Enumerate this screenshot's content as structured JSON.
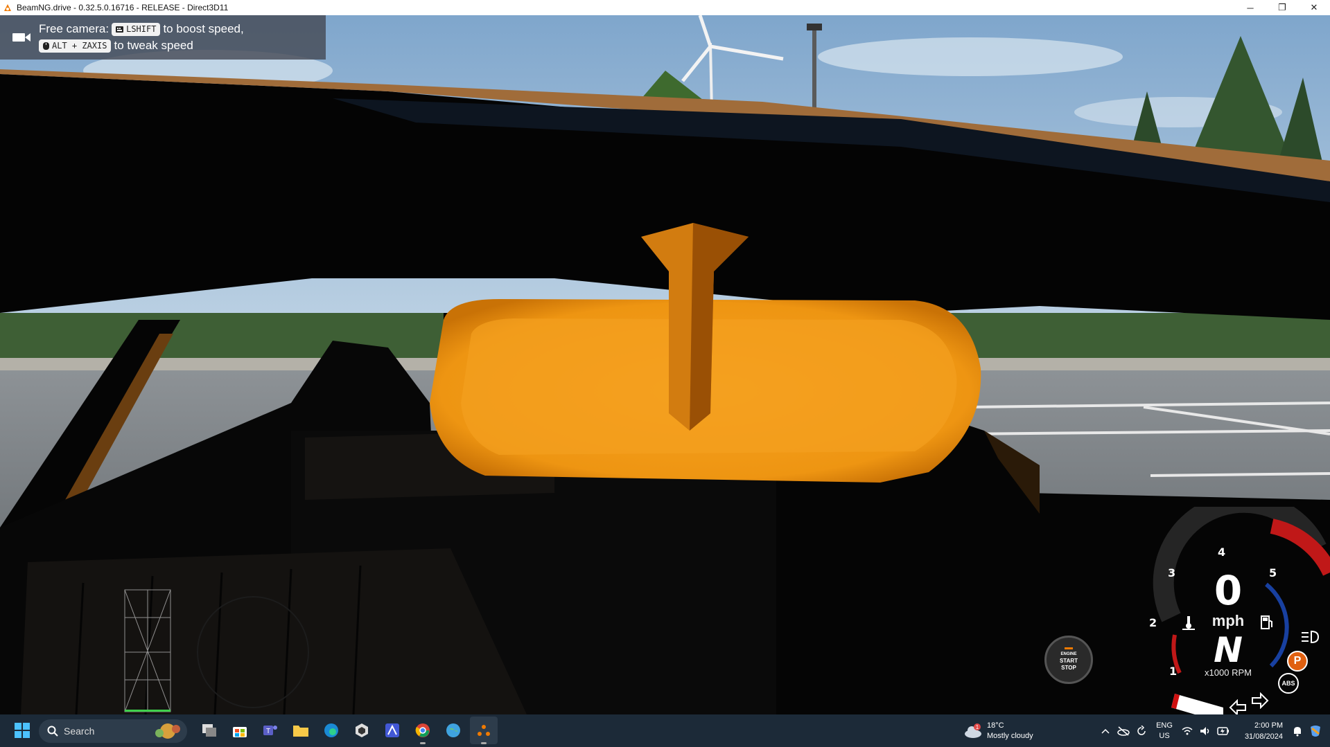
{
  "window": {
    "title": "BeamNG.drive - 0.32.5.0.16716 - RELEASE - Direct3D11",
    "minimize_glyph": "─",
    "maximize_glyph": "❐",
    "close_glyph": "✕"
  },
  "hint": {
    "line1_prefix": "Free camera:",
    "key1": "LSHIFT",
    "line1_suffix": "to boost speed,",
    "key2": "ALT + ZAXIS",
    "line2_suffix": "to tweak speed"
  },
  "hud": {
    "start_stop": {
      "line1": "ENGINE",
      "line2": "START",
      "line3": "STOP"
    },
    "speed": "0",
    "speed_unit": "mph",
    "gear": "N",
    "rpm_label": "x1000 RPM",
    "ticks": [
      "1",
      "2",
      "3",
      "4",
      "5"
    ],
    "indicators": [
      "temperature-icon",
      "fuel-icon",
      "headlight-icon",
      "parking-brake-icon",
      "abs-icon"
    ],
    "parking_label": "P",
    "abs_label": "ABS"
  },
  "taskbar": {
    "search_label": "Search",
    "weather": {
      "temp": "18°C",
      "condition": "Mostly cloudy",
      "badge": "1"
    },
    "lang": {
      "line1": "ENG",
      "line2": "US"
    },
    "time": "2:00 PM",
    "date": "31/08/2024",
    "apps": [
      "file-explorer",
      "store",
      "teams",
      "folder",
      "edge",
      "unity",
      "affinity",
      "chrome",
      "weather-app",
      "beamng"
    ]
  },
  "colors": {
    "accent_orange": "#f0a020",
    "taskbar_bg": "#1c2a38",
    "gauge_red": "#c01818",
    "gauge_blue": "#1840a0"
  }
}
